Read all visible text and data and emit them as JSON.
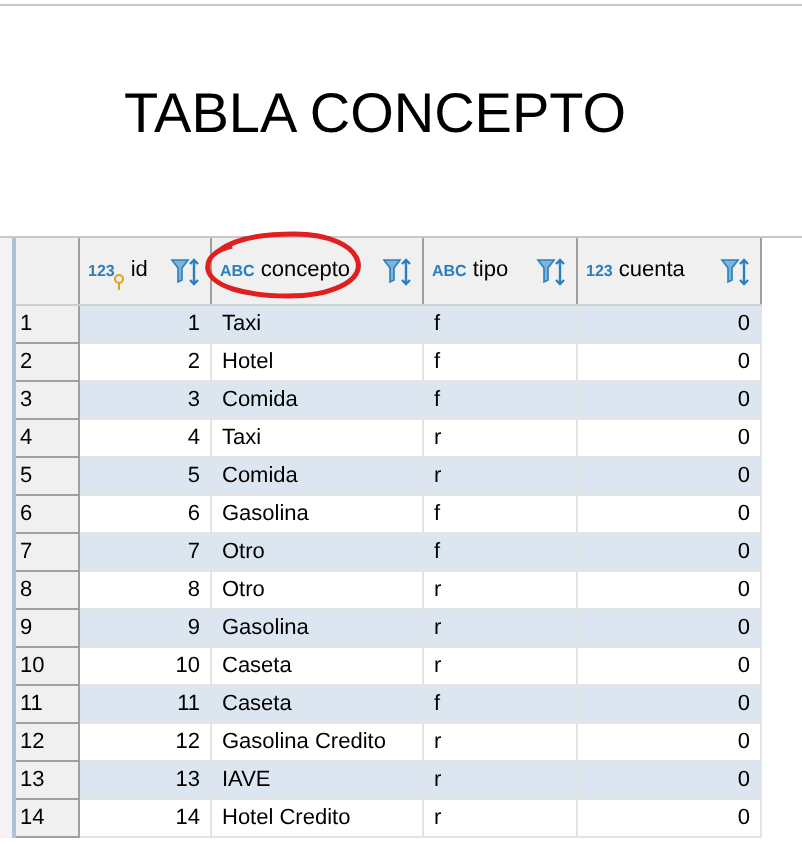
{
  "title": "TABLA CONCEPTO",
  "table": {
    "columns": [
      {
        "type_label": "123",
        "name": "id",
        "kind": "number",
        "key_icon": true,
        "circled": false
      },
      {
        "type_label": "ABC",
        "name": "concepto",
        "kind": "text",
        "key_icon": false,
        "circled": true
      },
      {
        "type_label": "ABC",
        "name": "tipo",
        "kind": "text",
        "key_icon": false,
        "circled": false
      },
      {
        "type_label": "123",
        "name": "cuenta",
        "kind": "number",
        "key_icon": false,
        "circled": false
      }
    ],
    "rows": [
      {
        "number": "1",
        "cells": [
          "1",
          "Taxi",
          "f",
          "0"
        ]
      },
      {
        "number": "2",
        "cells": [
          "2",
          "Hotel",
          "f",
          "0"
        ]
      },
      {
        "number": "3",
        "cells": [
          "3",
          "Comida",
          "f",
          "0"
        ]
      },
      {
        "number": "4",
        "cells": [
          "4",
          "Taxi",
          "r",
          "0"
        ]
      },
      {
        "number": "5",
        "cells": [
          "5",
          "Comida",
          "r",
          "0"
        ]
      },
      {
        "number": "6",
        "cells": [
          "6",
          "Gasolina",
          "f",
          "0"
        ]
      },
      {
        "number": "7",
        "cells": [
          "7",
          "Otro",
          "f",
          "0"
        ]
      },
      {
        "number": "8",
        "cells": [
          "8",
          "Otro",
          "r",
          "0"
        ]
      },
      {
        "number": "9",
        "cells": [
          "9",
          "Gasolina",
          "r",
          "0"
        ]
      },
      {
        "number": "10",
        "cells": [
          "10",
          "Caseta",
          "r",
          "0"
        ]
      },
      {
        "number": "11",
        "cells": [
          "11",
          "Caseta",
          "f",
          "0"
        ]
      },
      {
        "number": "12",
        "cells": [
          "12",
          "Gasolina Credito",
          "r",
          "0"
        ]
      },
      {
        "number": "13",
        "cells": [
          "13",
          "IAVE",
          "r",
          "0"
        ]
      },
      {
        "number": "14",
        "cells": [
          "14",
          "Hotel Credito",
          "r",
          "0"
        ]
      }
    ]
  }
}
